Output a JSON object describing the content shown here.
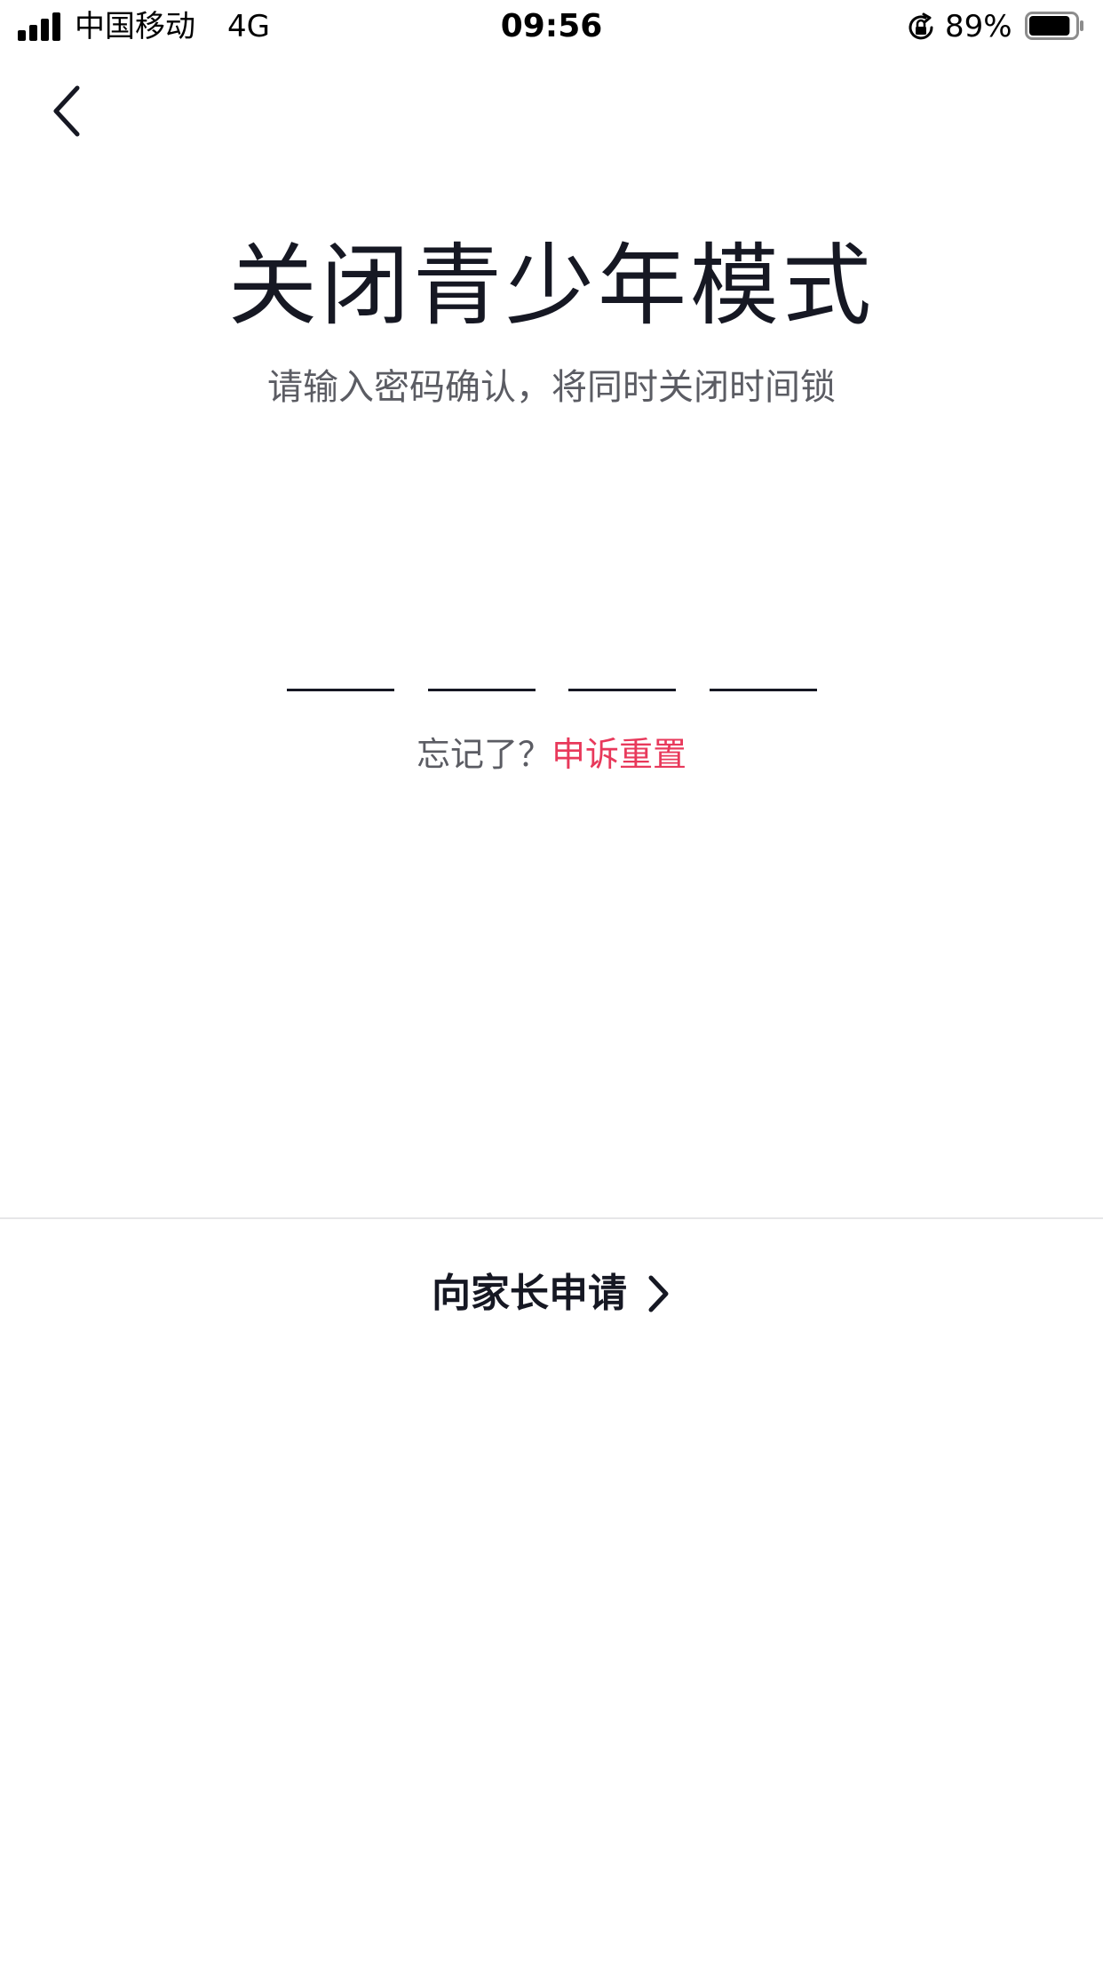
{
  "status_bar": {
    "carrier": "中国移动",
    "network": "4G",
    "time": "09:56",
    "battery_percent": "89%",
    "battery_level": 0.89
  },
  "icons": {
    "back": "chevron-left-icon",
    "forward": "chevron-right-icon",
    "signal": "cellular-signal-icon",
    "rotation_lock": "rotation-lock-icon",
    "battery": "battery-icon"
  },
  "header": {
    "title": "关闭青少年模式",
    "subtitle": "请输入密码确认，将同时关闭时间锁"
  },
  "passcode": {
    "digits": [
      "",
      "",
      "",
      ""
    ]
  },
  "forgot": {
    "prompt": "忘记了？",
    "link": "申诉重置"
  },
  "bottom_action": {
    "label": "向家长申请"
  },
  "colors": {
    "text_primary": "#161823",
    "text_secondary": "#5b5c63",
    "accent": "#e8395b",
    "divider": "#e6e6e8",
    "background": "#ffffff"
  }
}
